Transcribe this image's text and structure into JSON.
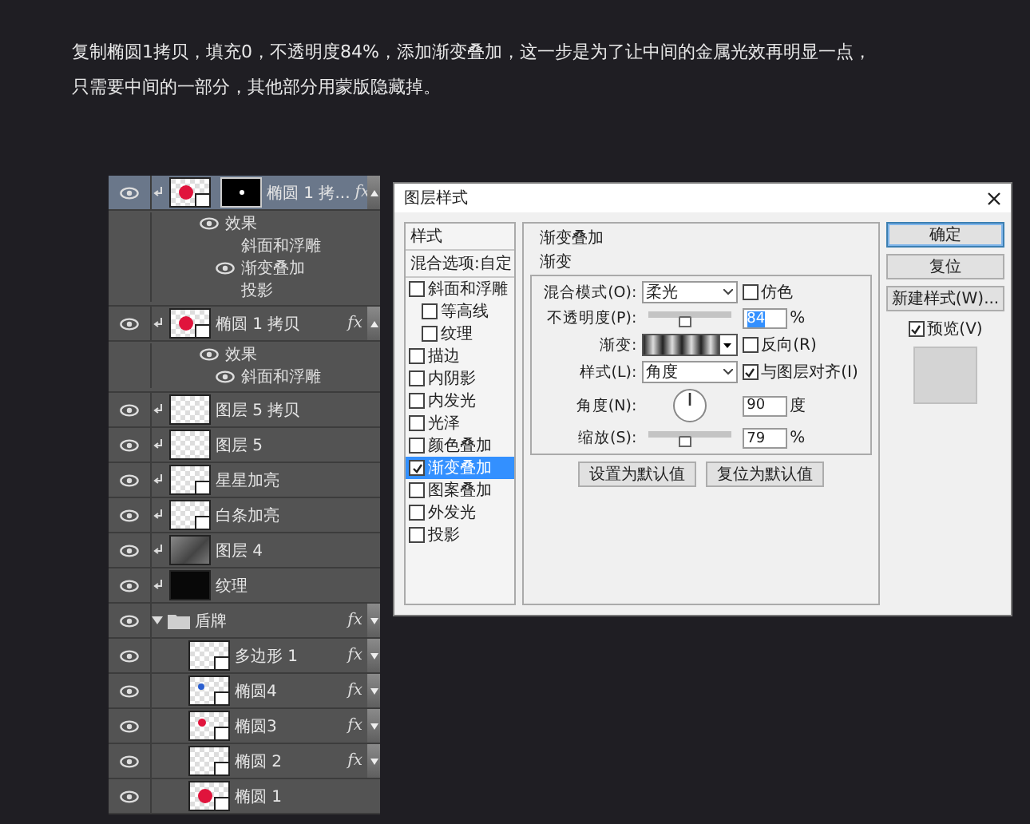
{
  "caption": {
    "lines": [
      "复制椭圆1拷贝，填充0，不透明度84%，添加渐变叠加，这一步是为了让中间的金属光效再明显一点，",
      "只需要中间的一部分，其他部分用蒙版隐藏掉。"
    ]
  },
  "layers": [
    {
      "kind": "layer",
      "name": "椭圆 1 拷...",
      "visible": true,
      "clipped": true,
      "thumbnail": {
        "kind": "large-dot",
        "color": "#e0143c"
      },
      "vector": true,
      "mask": true,
      "badge": "fx",
      "selected": true,
      "effects": [
        {
          "label": "效果",
          "visible": true,
          "children": [
            {
              "label": "斜面和浮雕",
              "visible": false
            },
            {
              "label": "渐变叠加",
              "visible": true
            },
            {
              "label": "投影",
              "visible": false
            }
          ]
        }
      ]
    },
    {
      "kind": "layer",
      "name": "椭圆 1 拷贝",
      "visible": true,
      "clipped": true,
      "thumbnail": {
        "kind": "large-dot",
        "color": "#e0143c"
      },
      "vector": true,
      "mask": false,
      "badge": "fx",
      "selected": false,
      "effects": [
        {
          "label": "效果",
          "visible": true,
          "children": [
            {
              "label": "斜面和浮雕",
              "visible": true
            }
          ]
        }
      ]
    },
    {
      "kind": "layer",
      "name": "图层 5 拷贝",
      "visible": true,
      "clipped": true,
      "thumbnail": {
        "kind": "blank"
      },
      "vector": false,
      "mask": false,
      "selected": false
    },
    {
      "kind": "layer",
      "name": "图层 5",
      "visible": true,
      "clipped": true,
      "thumbnail": {
        "kind": "blank"
      },
      "vector": false,
      "mask": false,
      "selected": false
    },
    {
      "kind": "layer",
      "name": "星星加亮",
      "visible": true,
      "clipped": true,
      "thumbnail": {
        "kind": "blank"
      },
      "vector": true,
      "mask": false,
      "selected": false
    },
    {
      "kind": "layer",
      "name": "白条加亮",
      "visible": true,
      "clipped": true,
      "thumbnail": {
        "kind": "blank"
      },
      "vector": true,
      "mask": false,
      "selected": false
    },
    {
      "kind": "layer",
      "name": "图层 4",
      "visible": true,
      "clipped": true,
      "thumbnail": {
        "kind": "texture"
      },
      "vector": false,
      "mask": false,
      "selected": false
    },
    {
      "kind": "layer",
      "name": "纹理",
      "visible": true,
      "clipped": true,
      "thumbnail": {
        "kind": "black"
      },
      "vector": false,
      "mask": false,
      "selected": false
    },
    {
      "kind": "group",
      "name": "盾牌",
      "visible": true,
      "expanded": true,
      "badge": "fx",
      "selected": false,
      "children": [
        {
          "kind": "layer",
          "name": "多边形 1",
          "visible": true,
          "clipped": false,
          "thumbnail": {
            "kind": "blank"
          },
          "vector": true,
          "mask": false,
          "badge": "fx",
          "selected": false
        },
        {
          "kind": "layer",
          "name": "椭圆4",
          "visible": true,
          "clipped": false,
          "thumbnail": {
            "kind": "small-dot",
            "color": "#2b5fd0"
          },
          "vector": true,
          "mask": false,
          "badge": "fx",
          "selected": false
        },
        {
          "kind": "layer",
          "name": "椭圆3",
          "visible": true,
          "clipped": false,
          "thumbnail": {
            "kind": "medium-dot",
            "color": "#e0143c"
          },
          "vector": true,
          "mask": false,
          "badge": "fx",
          "selected": false
        },
        {
          "kind": "layer",
          "name": "椭圆 2",
          "visible": true,
          "clipped": false,
          "thumbnail": {
            "kind": "blank"
          },
          "vector": true,
          "mask": false,
          "badge": "fx",
          "selected": false
        },
        {
          "kind": "layer",
          "name": "椭圆 1",
          "visible": true,
          "clipped": false,
          "thumbnail": {
            "kind": "large-dot",
            "color": "#e0143c"
          },
          "vector": true,
          "mask": false,
          "selected": false
        }
      ]
    }
  ],
  "dialog": {
    "title": "图层样式",
    "styles": [
      {
        "kind": "header",
        "label": "样式"
      },
      {
        "kind": "header",
        "label": "混合选项:自定"
      },
      {
        "kind": "check",
        "label": "斜面和浮雕",
        "checked": false,
        "selected": false,
        "children": [
          {
            "kind": "check",
            "label": "等高线",
            "checked": false,
            "selected": false
          },
          {
            "kind": "check",
            "label": "纹理",
            "checked": false,
            "selected": false
          }
        ]
      },
      {
        "kind": "check",
        "label": "描边",
        "checked": false,
        "selected": false
      },
      {
        "kind": "check",
        "label": "内阴影",
        "checked": false,
        "selected": false
      },
      {
        "kind": "check",
        "label": "内发光",
        "checked": false,
        "selected": false
      },
      {
        "kind": "check",
        "label": "光泽",
        "checked": false,
        "selected": false
      },
      {
        "kind": "check",
        "label": "颜色叠加",
        "checked": false,
        "selected": false
      },
      {
        "kind": "check",
        "label": "渐变叠加",
        "checked": true,
        "selected": true
      },
      {
        "kind": "check",
        "label": "图案叠加",
        "checked": false,
        "selected": false
      },
      {
        "kind": "check",
        "label": "外发光",
        "checked": false,
        "selected": false
      },
      {
        "kind": "check",
        "label": "投影",
        "checked": false,
        "selected": false
      }
    ],
    "section": "渐变叠加",
    "group": "渐变",
    "rows": [
      {
        "kind": "select",
        "label": "混合模式(O):",
        "value": "柔光",
        "option": {
          "label": "仿色",
          "checked": false
        }
      },
      {
        "kind": "slider",
        "label": "不透明度(P):",
        "level": 0.45,
        "value": "84",
        "text_selected": true,
        "unit": "%"
      },
      {
        "kind": "gradient",
        "label": "渐变:",
        "option": {
          "label": "反向(R)",
          "checked": false
        }
      },
      {
        "kind": "select",
        "label": "样式(L):",
        "value": "角度",
        "option": {
          "label": "与图层对齐(I)",
          "checked": true
        }
      },
      {
        "kind": "dial",
        "label": "角度(N):",
        "value": "90",
        "text_selected": false,
        "unit": "度"
      },
      {
        "kind": "slider",
        "label": "缩放(S):",
        "level": 0.45,
        "value": "79",
        "text_selected": false,
        "unit": "%"
      }
    ],
    "default_buttons": [
      "设置为默认值",
      "复位为默认值"
    ],
    "buttons": [
      {
        "label": "确定",
        "default": true
      },
      {
        "label": "复位",
        "default": false
      },
      {
        "label": "新建样式(W)...",
        "default": false
      }
    ],
    "preview": {
      "label": "预览(V)",
      "checked": true
    }
  }
}
